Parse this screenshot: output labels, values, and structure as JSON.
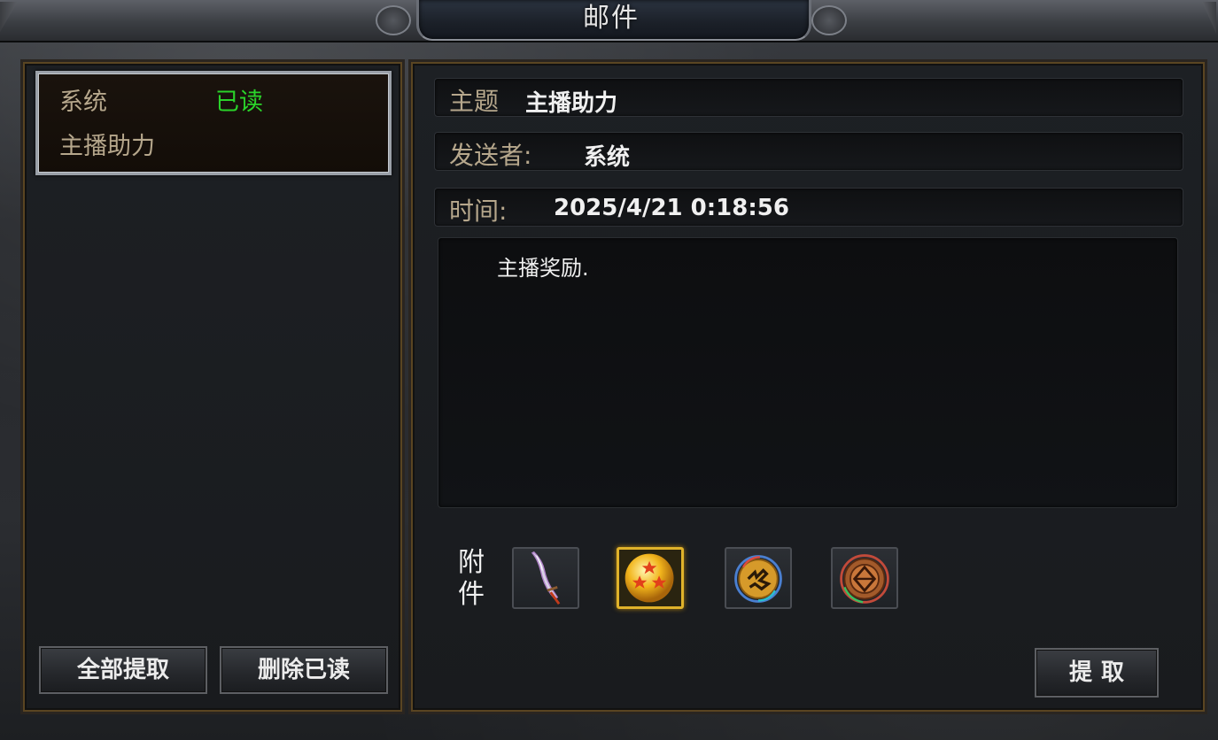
{
  "window": {
    "title": "邮件"
  },
  "mail_list": {
    "items": [
      {
        "sender": "系统",
        "status": "已读",
        "subject": "主播助力"
      }
    ]
  },
  "left_buttons": {
    "claim_all": "全部提取",
    "delete_read": "删除已读"
  },
  "detail": {
    "subject_label": "主题",
    "subject_value": "主播助力",
    "sender_label": "发送者:",
    "sender_value": "系统",
    "time_label": "时间:",
    "time_value": "2025/4/21 0:18:56",
    "body": "主播奖励."
  },
  "attachments": {
    "label": "附件",
    "items": [
      {
        "icon": "sword-icon"
      },
      {
        "icon": "golden-star-orb-icon",
        "selected": true
      },
      {
        "icon": "rune-medallion-icon"
      },
      {
        "icon": "bronze-seal-icon"
      }
    ]
  },
  "claim_button": "提取",
  "colors": {
    "accent_green": "#2ad32a",
    "label_tan": "#b6a78c",
    "selected_gold": "#e0b22a",
    "panel_border": "#5a4522"
  }
}
